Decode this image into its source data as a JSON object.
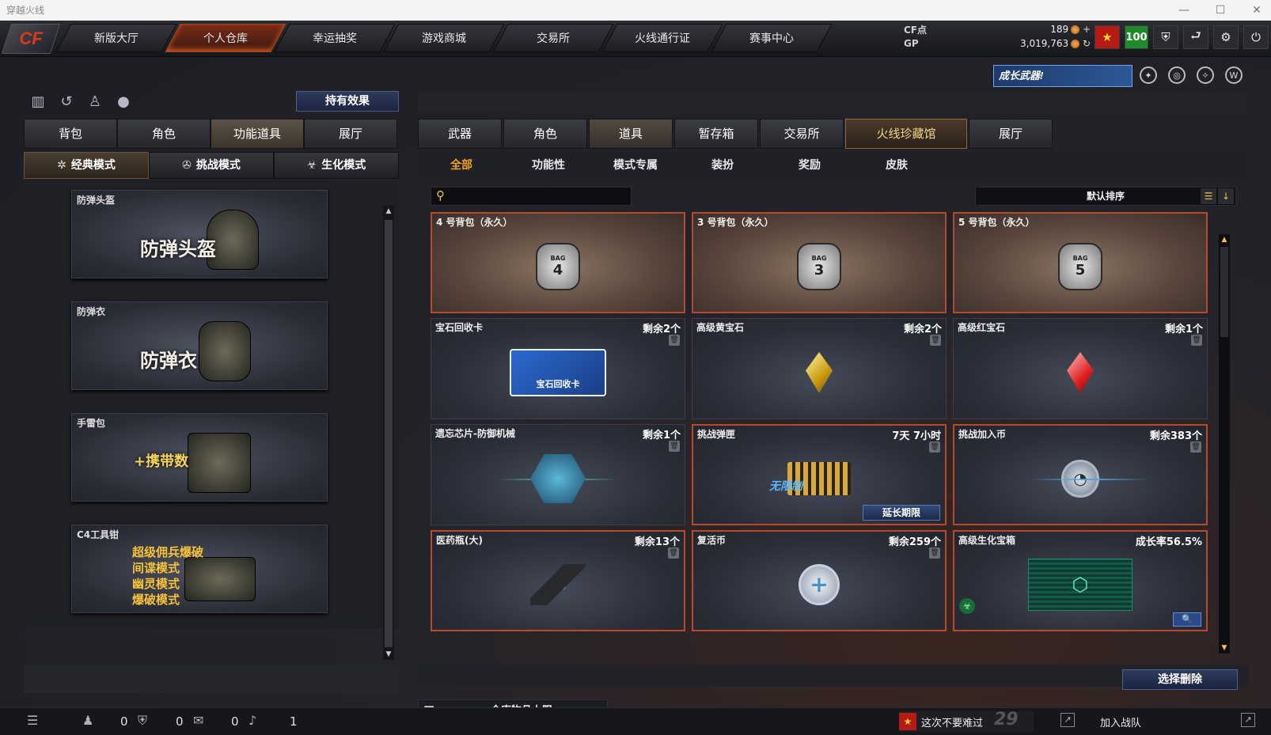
{
  "window": {
    "title": "穿越火线",
    "controls": [
      "—",
      "☐",
      "✕"
    ]
  },
  "logo": "CF",
  "nav": {
    "tabs": [
      "新版大厅",
      "个人仓库",
      "幸运抽奖",
      "游戏商城",
      "交易所",
      "火线通行证",
      "赛事中心"
    ],
    "active": 1
  },
  "currency": {
    "cf_label": "CF点",
    "cf_value": "189",
    "cf_action": "+",
    "gp_label": "GP",
    "gp_value": "3,019,763",
    "gp_action": "↻"
  },
  "top_icons": {
    "vip": "★",
    "level": "100",
    "shield": "shield-icon",
    "return": "return-icon",
    "settings": "gear-icon",
    "power": "power-icon"
  },
  "banner": {
    "text": "成长武器!"
  },
  "left": {
    "effect_button": "持有效果",
    "categories": [
      "背包",
      "角色",
      "功能道具",
      "展厅"
    ],
    "active_category": 2,
    "modes": [
      "经典模式",
      "挑战模式",
      "生化模式"
    ],
    "mode_icons": [
      "✲",
      "✇",
      "☣"
    ],
    "active_mode": 0,
    "items": [
      {
        "name": "防弹头盔",
        "big": "防弹头盔"
      },
      {
        "name": "防弹衣",
        "big": "防弹衣"
      },
      {
        "name": "手雷包",
        "big": "+携带数"
      },
      {
        "name": "C4工具钳",
        "lines": [
          "超级佣兵爆破",
          "间谍模式",
          "幽灵模式",
          "爆破模式"
        ]
      }
    ]
  },
  "right": {
    "categories": [
      "武器",
      "角色",
      "道具",
      "暂存箱",
      "交易所",
      "火线珍藏馆",
      "展厅"
    ],
    "active_category": 2,
    "subtabs": [
      "全部",
      "功能性",
      "模式专属",
      "装扮",
      "奖励",
      "皮肤"
    ],
    "active_subtab": 0,
    "search": {
      "placeholder": ""
    },
    "sort": {
      "label": "默认排序",
      "list_icon": "☰",
      "down_icon": "↓"
    },
    "items": [
      {
        "name": "4 号背包（永久）",
        "right": "",
        "kind": "bag",
        "bag_no": "4"
      },
      {
        "name": "3 号背包（永久）",
        "right": "",
        "kind": "bag",
        "bag_no": "3"
      },
      {
        "name": "5 号背包（永久）",
        "right": "",
        "kind": "bag",
        "bag_no": "5"
      },
      {
        "name": "宝石回收卡",
        "right": "剩余2个",
        "kind": "card",
        "label": "宝石回收卡"
      },
      {
        "name": "高级黄宝石",
        "right": "剩余2个",
        "kind": "gem-yellow"
      },
      {
        "name": "高级红宝石",
        "right": "剩余1个",
        "kind": "gem-red"
      },
      {
        "name": "遗忘芯片-防御机械",
        "right": "剩余1个",
        "kind": "chip"
      },
      {
        "name": "挑战弹匣",
        "right": "7天 7小时",
        "kind": "ammo",
        "label": "无限制",
        "button": "延长期限"
      },
      {
        "name": "挑战加入币",
        "right": "剩余383个",
        "kind": "joincoin"
      },
      {
        "name": "医药瓶(大)",
        "right": "剩余13个",
        "kind": "medkit"
      },
      {
        "name": "复活币",
        "right": "剩余259个",
        "kind": "revive"
      },
      {
        "name": "高级生化宝箱",
        "right": "成长率56.5%",
        "kind": "chest"
      }
    ],
    "delete_button": "选择删除",
    "capacity_label": "仓库物品上限"
  },
  "statusbar": {
    "counts": [
      "0",
      "0",
      "0",
      "1"
    ],
    "notice": "这次不要难过",
    "notice_number": "29",
    "join_team": "加入战队"
  }
}
